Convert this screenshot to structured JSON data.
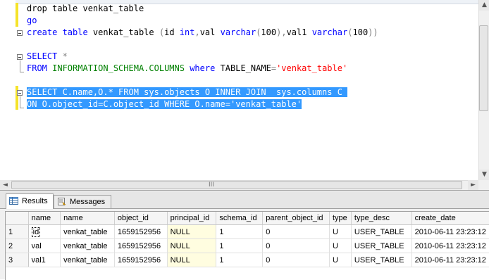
{
  "editor": {
    "lines": [
      {
        "segments": [
          {
            "text": "drop table venkat_table",
            "cls": "plain"
          }
        ]
      },
      {
        "segments": [
          {
            "text": "go",
            "cls": "kw"
          }
        ]
      },
      {
        "segments": [
          {
            "text": "create table",
            "cls": "kw"
          },
          {
            "text": " venkat_table ",
            "cls": "plain"
          },
          {
            "text": "(",
            "cls": "gray"
          },
          {
            "text": "id ",
            "cls": "plain"
          },
          {
            "text": "int",
            "cls": "kw"
          },
          {
            "text": ",",
            "cls": "gray"
          },
          {
            "text": "val ",
            "cls": "plain"
          },
          {
            "text": "varchar",
            "cls": "kw"
          },
          {
            "text": "(",
            "cls": "gray"
          },
          {
            "text": "100",
            "cls": "plain"
          },
          {
            "text": "),",
            "cls": "gray"
          },
          {
            "text": "val1 ",
            "cls": "plain"
          },
          {
            "text": "varchar",
            "cls": "kw"
          },
          {
            "text": "(",
            "cls": "gray"
          },
          {
            "text": "100",
            "cls": "plain"
          },
          {
            "text": "))",
            "cls": "gray"
          }
        ]
      },
      {
        "segments": []
      },
      {
        "segments": [
          {
            "text": "SELECT",
            "cls": "kw"
          },
          {
            "text": " *",
            "cls": "gray"
          }
        ]
      },
      {
        "segments": [
          {
            "text": "FROM",
            "cls": "kw"
          },
          {
            "text": " INFORMATION_SCHEMA.COLUMNS",
            "cls": "sys"
          },
          {
            "text": " where",
            "cls": "kw"
          },
          {
            "text": " TABLE_NAME",
            "cls": "plain"
          },
          {
            "text": "=",
            "cls": "gray"
          },
          {
            "text": "'venkat_table'",
            "cls": "str"
          }
        ]
      },
      {
        "segments": []
      },
      {
        "segments": [
          {
            "text": "SELECT C.name,O.* FROM sys.objects O INNER JOIN  sys.columns C ",
            "cls": "sel"
          }
        ]
      },
      {
        "segments": [
          {
            "text": "ON O.object_id=C.object_id WHERE O.name='venkat_table'",
            "cls": "sel"
          }
        ]
      }
    ]
  },
  "results": {
    "tabs": [
      {
        "label": "Results",
        "icon": "grid-icon",
        "active": true
      },
      {
        "label": "Messages",
        "icon": "messages-icon",
        "active": false
      }
    ],
    "columns": [
      "",
      "name",
      "name",
      "object_id",
      "principal_id",
      "schema_id",
      "parent_object_id",
      "type",
      "type_desc",
      "create_date"
    ],
    "rows": [
      [
        "1",
        "id",
        "venkat_table",
        "1659152956",
        "NULL",
        "1",
        "0",
        "U",
        "USER_TABLE",
        "2010-06-11 23:23:12"
      ],
      [
        "2",
        "val",
        "venkat_table",
        "1659152956",
        "NULL",
        "1",
        "0",
        "U",
        "USER_TABLE",
        "2010-06-11 23:23:12"
      ],
      [
        "3",
        "val1",
        "venkat_table",
        "1659152956",
        "NULL",
        "1",
        "0",
        "U",
        "USER_TABLE",
        "2010-06-11 23:23:12"
      ]
    ]
  },
  "scrollbars": {
    "up_arrow": "▲",
    "down_arrow": "▼",
    "left_arrow": "◄",
    "right_arrow": "►",
    "grip": "III"
  }
}
